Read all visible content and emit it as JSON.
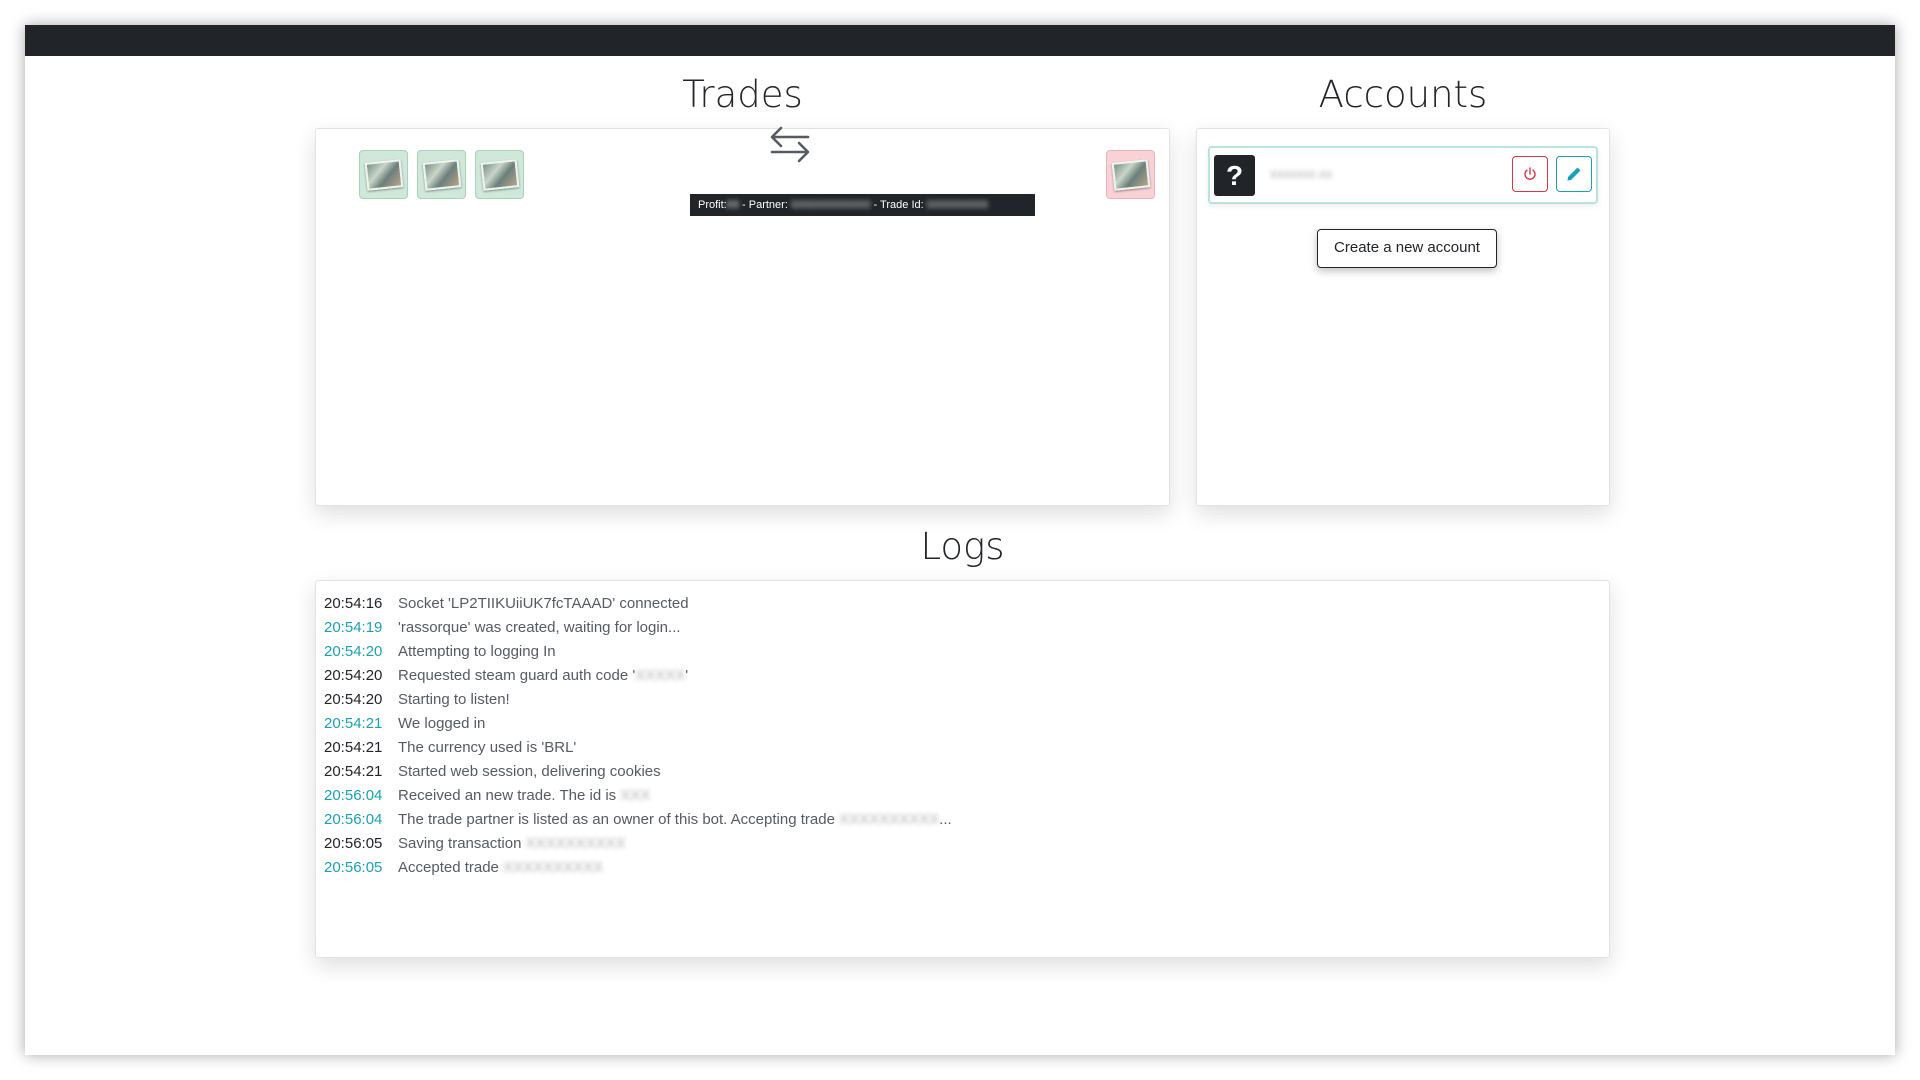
{
  "sections": {
    "trades_title": "Trades",
    "accounts_title": "Accounts",
    "logs_title": "Logs"
  },
  "trade": {
    "given_items": [
      {
        "icon": "item-image-icon"
      },
      {
        "icon": "item-image-icon"
      },
      {
        "icon": "item-image-icon"
      }
    ],
    "received_items": [
      {
        "icon": "item-image-icon"
      }
    ],
    "swap_icon": "swap-arrows-icon",
    "tooltip": {
      "profit_label": "Profit:",
      "partner_label": " - Partner:",
      "trade_id_label": " - Trade Id:"
    }
  },
  "accounts": {
    "items": [
      {
        "avatar": "?",
        "name": "hidden-name",
        "status_color": "#b8e2dc"
      }
    ],
    "create_label": "Create a new account"
  },
  "logs": [
    {
      "time": "20:54:16",
      "time_color": "dark",
      "message": "Socket 'LP2TIIKUiiUK7fcTAAAD' connected",
      "redacted": ""
    },
    {
      "time": "20:54:19",
      "time_color": "cyan",
      "message": "'rassorque' was created, waiting for login...",
      "redacted": ""
    },
    {
      "time": "20:54:20",
      "time_color": "cyan",
      "message": "Attempting to logging In",
      "redacted": ""
    },
    {
      "time": "20:54:20",
      "time_color": "dark",
      "message": "Requested steam guard auth code '",
      "redacted": "XXXXX",
      "suffix": "'"
    },
    {
      "time": "20:54:20",
      "time_color": "dark",
      "message": "Starting to listen!",
      "redacted": ""
    },
    {
      "time": "20:54:21",
      "time_color": "cyan",
      "message": "We logged in",
      "redacted": ""
    },
    {
      "time": "20:54:21",
      "time_color": "dark",
      "message": "The currency used is 'BRL'",
      "redacted": ""
    },
    {
      "time": "20:54:21",
      "time_color": "dark",
      "message": "Started web session, delivering cookies",
      "redacted": ""
    },
    {
      "time": "20:56:04",
      "time_color": "cyan",
      "message": "Received an new trade. The id is ",
      "redacted": "XXX"
    },
    {
      "time": "20:56:04",
      "time_color": "cyan",
      "message": "The trade partner is listed as an owner of this bot. Accepting trade ",
      "redacted": "XXXXXXXXXX",
      "suffix": "..."
    },
    {
      "time": "20:56:05",
      "time_color": "dark",
      "message": "Saving transaction ",
      "redacted": "XXXXXXXXXX"
    },
    {
      "time": "20:56:05",
      "time_color": "cyan",
      "message": "Accepted trade ",
      "redacted": "XXXXXXXXXX"
    }
  ],
  "colors": {
    "navbar": "#212529",
    "accent_cyan": "#17a2b8",
    "danger_red": "#dc3545",
    "give_item_bg": "#cfe8da",
    "receive_item_bg": "#f8d2d6"
  }
}
